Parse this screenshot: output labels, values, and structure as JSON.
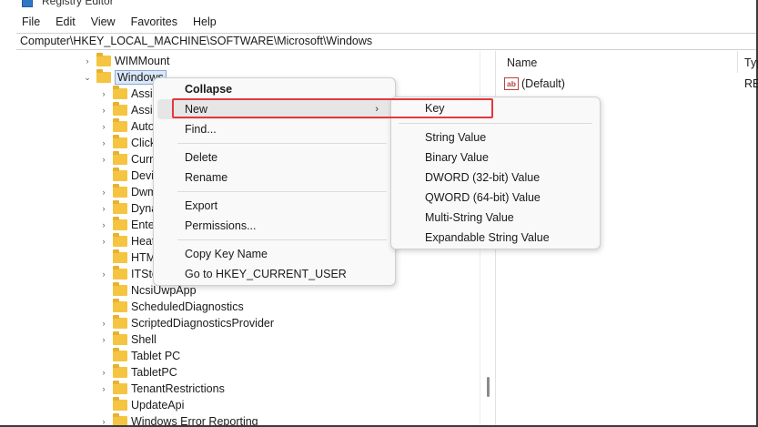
{
  "window": {
    "title": "Registry Editor"
  },
  "menu": [
    "File",
    "Edit",
    "View",
    "Favorites",
    "Help"
  ],
  "address": "Computer\\HKEY_LOCAL_MACHINE\\SOFTWARE\\Microsoft\\Windows",
  "tree": {
    "parent_items": [
      {
        "label": "WIMMount",
        "expander": "right"
      },
      {
        "label": "Windows",
        "expander": "down",
        "selected": true
      }
    ],
    "children": [
      {
        "label": "Assig",
        "expander": true
      },
      {
        "label": "Assig",
        "expander": true
      },
      {
        "label": "Autop",
        "expander": true
      },
      {
        "label": "Click",
        "expander": true
      },
      {
        "label": "Curre",
        "expander": true
      },
      {
        "label": "Devic",
        "expander": false
      },
      {
        "label": "Dwm",
        "expander": true
      },
      {
        "label": "Dyna",
        "expander": true
      },
      {
        "label": "Enter",
        "expander": true
      },
      {
        "label": "Heat",
        "expander": true
      },
      {
        "label": "HTM",
        "expander": false
      },
      {
        "label": "ITSto",
        "expander": true
      },
      {
        "label": "NcsiUwpApp",
        "expander": false
      },
      {
        "label": "ScheduledDiagnostics",
        "expander": false
      },
      {
        "label": "ScriptedDiagnosticsProvider",
        "expander": true
      },
      {
        "label": "Shell",
        "expander": true
      },
      {
        "label": "Tablet PC",
        "expander": false
      },
      {
        "label": "TabletPC",
        "expander": true
      },
      {
        "label": "TenantRestrictions",
        "expander": true
      },
      {
        "label": "UpdateApi",
        "expander": false
      },
      {
        "label": "Windows Error Reporting",
        "expander": true
      }
    ]
  },
  "list": {
    "columns": {
      "name": "Name",
      "type": "Typ"
    },
    "rows": [
      {
        "name": "(Default)",
        "type": "RE",
        "icon": "ab"
      }
    ]
  },
  "context_menu": {
    "collapse": "Collapse",
    "new": "New",
    "find": "Find...",
    "delete": "Delete",
    "rename": "Rename",
    "export": "Export",
    "permissions": "Permissions...",
    "copy_key_name": "Copy Key Name",
    "goto_hkcu": "Go to HKEY_CURRENT_USER",
    "submenu_arrow": "›"
  },
  "submenu": {
    "key": "Key",
    "values": [
      "String Value",
      "Binary Value",
      "DWORD (32-bit) Value",
      "QWORD (64-bit) Value",
      "Multi-String Value",
      "Expandable String Value"
    ]
  },
  "colors": {
    "highlight": "#e0393e",
    "folder": "#f5c542",
    "selection": "#dbe8fa"
  },
  "icons": {
    "chevron_right": "›",
    "chevron_down": "⌄"
  }
}
